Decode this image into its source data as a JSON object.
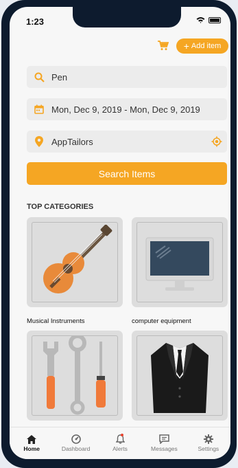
{
  "status": {
    "time": "1:23"
  },
  "header": {
    "add_item_label": "Add item"
  },
  "search": {
    "query": "Pen"
  },
  "dates": {
    "range": "Mon, Dec 9, 2019 - Mon, Dec 9, 2019"
  },
  "location": {
    "value": "AppTailors"
  },
  "search_button": {
    "label": "Search Items"
  },
  "categories": {
    "title": "TOP CATEGORIES",
    "items": [
      {
        "label": "Musical Instruments",
        "icon": "guitar-icon"
      },
      {
        "label": "computer equipment",
        "icon": "monitor-icon"
      },
      {
        "label": "",
        "icon": "tools-icon"
      },
      {
        "label": "",
        "icon": "suit-icon"
      }
    ]
  },
  "tabs": [
    {
      "label": "Home",
      "icon": "home-icon",
      "active": true
    },
    {
      "label": "Dashboard",
      "icon": "dashboard-icon"
    },
    {
      "label": "Alerts",
      "icon": "bell-icon"
    },
    {
      "label": "Messages",
      "icon": "message-icon"
    },
    {
      "label": "Settings",
      "icon": "gear-icon"
    }
  ],
  "colors": {
    "accent": "#f5a623",
    "background": "#f7f7f7",
    "frame": "#0d1b2e"
  }
}
